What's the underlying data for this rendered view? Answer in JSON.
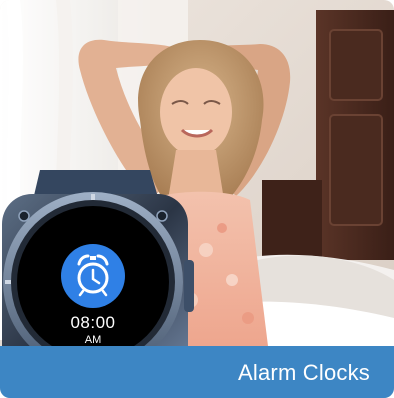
{
  "caption": {
    "text": "Alarm Clocks"
  },
  "watch": {
    "time": "08:00",
    "ampm": "AM",
    "icon": "alarm-clock-icon",
    "accent_color": "#2f80e6"
  },
  "colors": {
    "banner": "#3d86c4",
    "wall": "#f2eee9",
    "dress": "#f1b7a2"
  }
}
